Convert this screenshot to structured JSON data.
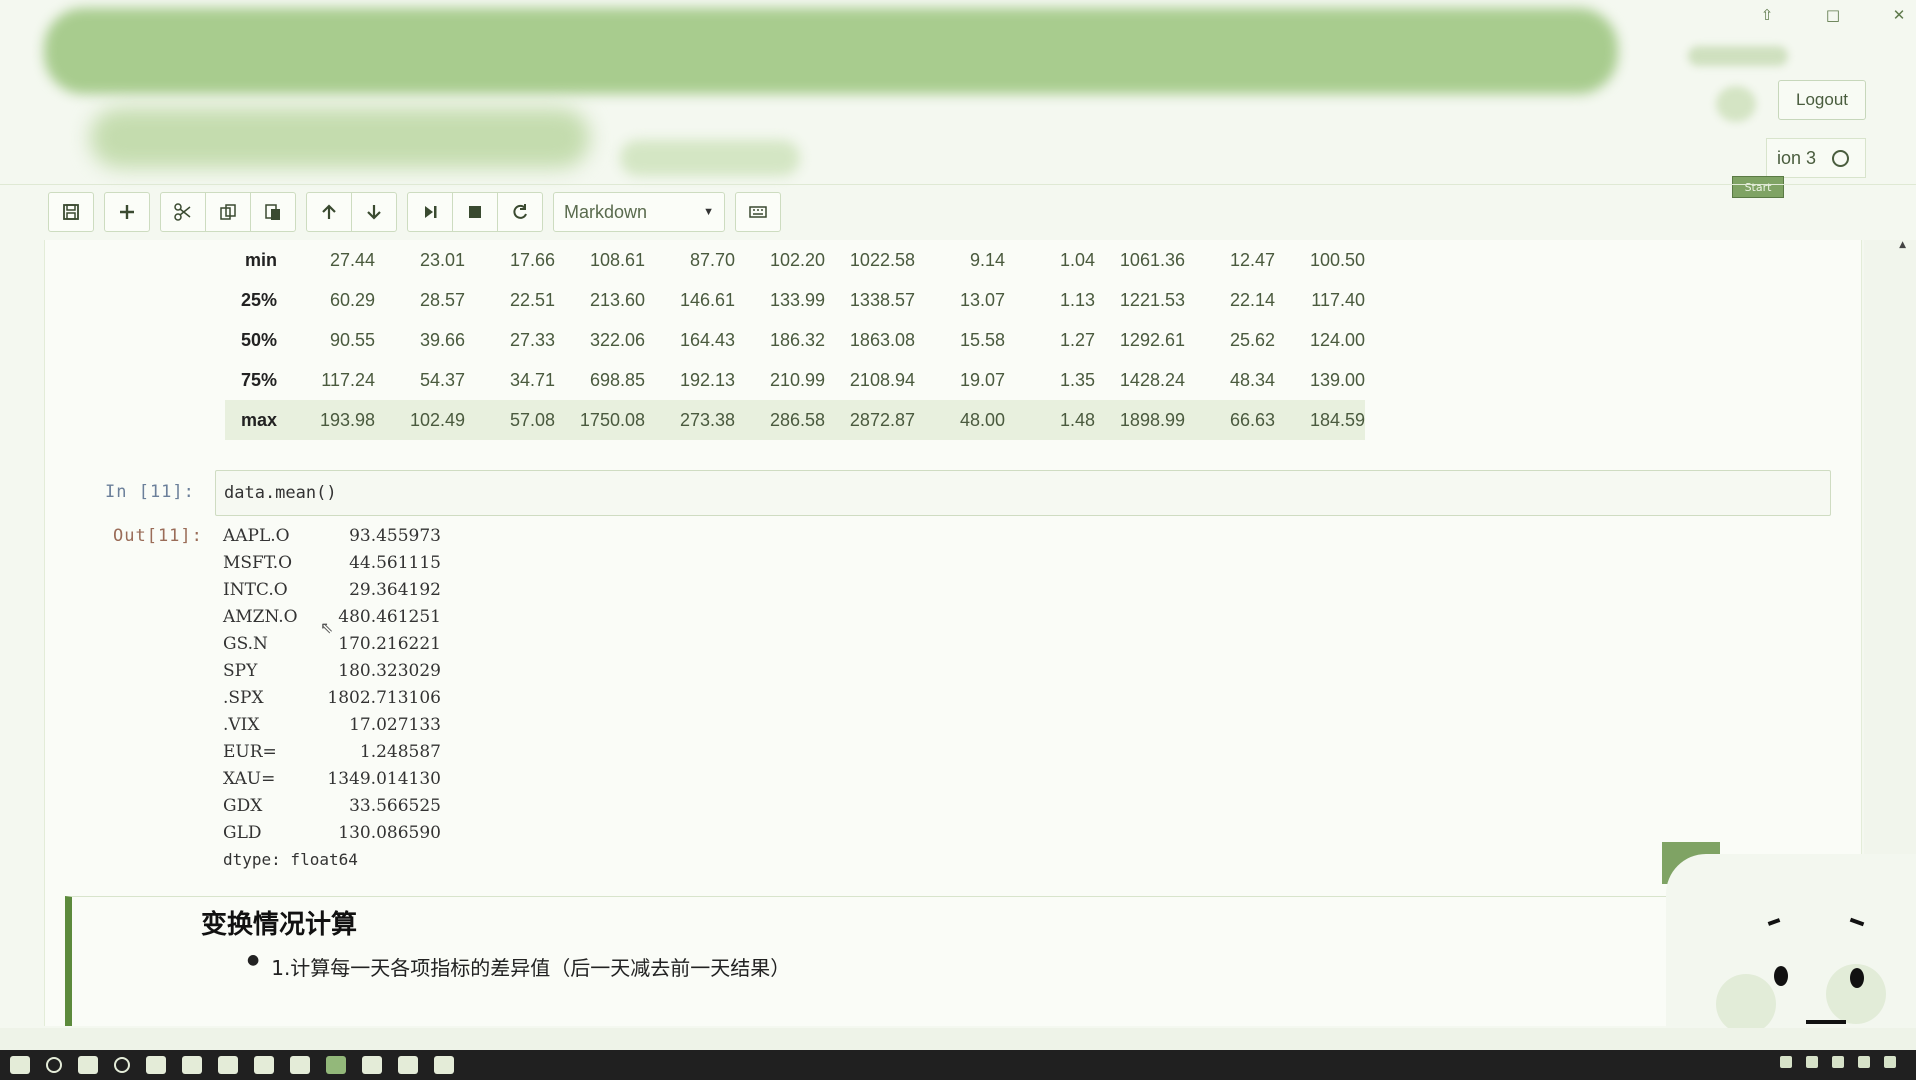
{
  "header": {
    "logout_label": "Logout",
    "kernel_label": "ion 3",
    "start_badge": "Start"
  },
  "window_controls": [
    "⇧",
    "□",
    "✕"
  ],
  "toolbar": {
    "cell_type": "Markdown",
    "buttons": [
      "save",
      "add",
      "cut",
      "copy",
      "paste",
      "move-up",
      "move-down",
      "run",
      "stop",
      "restart",
      "keyboard"
    ]
  },
  "describe_table": {
    "rows": [
      {
        "label": "min",
        "values": [
          "27.44",
          "23.01",
          "17.66",
          "108.61",
          "87.70",
          "102.20",
          "1022.58",
          "9.14",
          "1.04",
          "1061.36",
          "12.47",
          "100.50"
        ]
      },
      {
        "label": "25%",
        "values": [
          "60.29",
          "28.57",
          "22.51",
          "213.60",
          "146.61",
          "133.99",
          "1338.57",
          "13.07",
          "1.13",
          "1221.53",
          "22.14",
          "117.40"
        ]
      },
      {
        "label": "50%",
        "values": [
          "90.55",
          "39.66",
          "27.33",
          "322.06",
          "164.43",
          "186.32",
          "1863.08",
          "15.58",
          "1.27",
          "1292.61",
          "25.62",
          "124.00"
        ]
      },
      {
        "label": "75%",
        "values": [
          "117.24",
          "54.37",
          "34.71",
          "698.85",
          "192.13",
          "210.99",
          "2108.94",
          "19.07",
          "1.35",
          "1428.24",
          "48.34",
          "139.00"
        ]
      },
      {
        "label": "max",
        "values": [
          "193.98",
          "102.49",
          "57.08",
          "1750.08",
          "273.38",
          "286.58",
          "2872.87",
          "48.00",
          "1.48",
          "1898.99",
          "66.63",
          "184.59"
        ]
      }
    ]
  },
  "cell_11": {
    "in_prompt": "In [11]:",
    "code": "data.mean()",
    "out_prompt": "Out[11]:",
    "output": [
      {
        "key": "AAPL.O",
        "value": "93.455973"
      },
      {
        "key": "MSFT.O",
        "value": "44.561115"
      },
      {
        "key": "INTC.O",
        "value": "29.364192"
      },
      {
        "key": "AMZN.O",
        "value": "480.461251"
      },
      {
        "key": "GS.N",
        "value": "170.216221"
      },
      {
        "key": "SPY",
        "value": "180.323029"
      },
      {
        "key": ".SPX",
        "value": "1802.713106"
      },
      {
        "key": ".VIX",
        "value": "17.027133"
      },
      {
        "key": "EUR=",
        "value": "1.248587"
      },
      {
        "key": "XAU=",
        "value": "1349.014130"
      },
      {
        "key": "GDX",
        "value": "33.566525"
      },
      {
        "key": "GLD",
        "value": "130.086590"
      }
    ],
    "dtype": "dtype: float64"
  },
  "markdown": {
    "heading": "变换情况计算",
    "bullet": "1.计算每一天各项指标的差异值（后一天减去前一天结果）"
  }
}
